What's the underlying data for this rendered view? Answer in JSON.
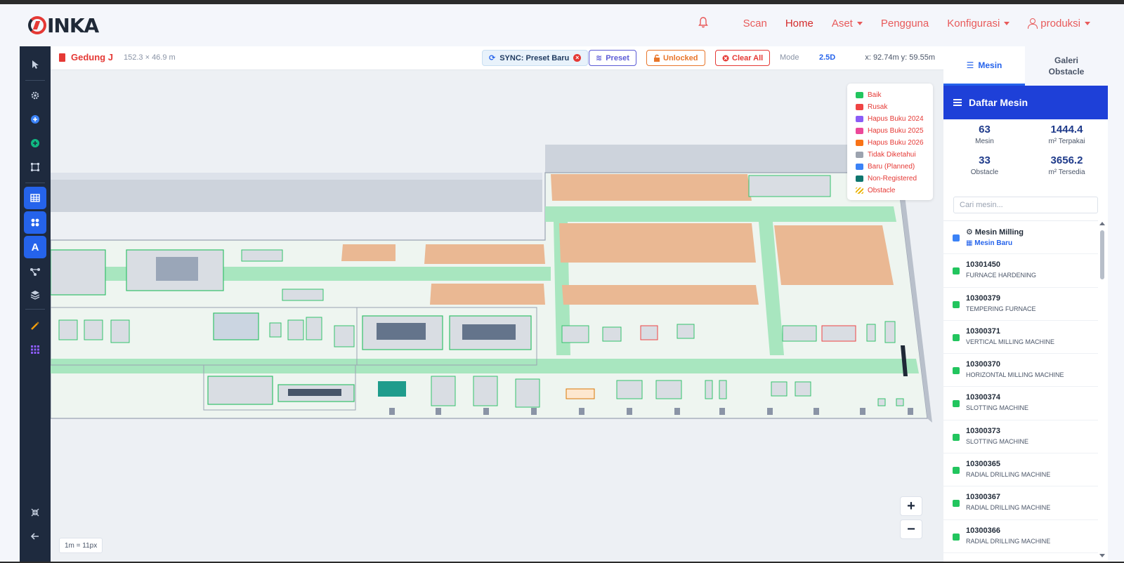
{
  "brand": {
    "logo_text": "INKA"
  },
  "nav": {
    "items": [
      {
        "label": "Scan"
      },
      {
        "label": "Home"
      },
      {
        "label": "Aset"
      },
      {
        "label": "Pengguna"
      },
      {
        "label": "Konfigurasi"
      },
      {
        "label": "produksi"
      }
    ]
  },
  "map": {
    "building": "Gedung J",
    "dimensions": "152.3 × 46.9 m",
    "sync_label": "SYNC: Preset Baru",
    "preset_label": "Preset",
    "unlocked_label": "Unlocked",
    "clear_label": "Clear All",
    "mode_label": "Mode",
    "mode_value": "2.5D",
    "coord": "x: 92.74m y: 59.55m",
    "scale": "1m = 11px",
    "zoom_in": "+",
    "zoom_out": "−",
    "legend": [
      {
        "label": "Baik",
        "color": "#22c55e"
      },
      {
        "label": "Rusak",
        "color": "#ef4444"
      },
      {
        "label": "Hapus Buku 2024",
        "color": "#8b5cf6"
      },
      {
        "label": "Hapus Buku 2025",
        "color": "#ec4899"
      },
      {
        "label": "Hapus Buku 2026",
        "color": "#f97316"
      },
      {
        "label": "Tidak Diketahui",
        "color": "#9ca3af"
      },
      {
        "label": "Baru (Planned)",
        "color": "#3b82f6"
      },
      {
        "label": "Non-Registered",
        "color": "#0f766e"
      },
      {
        "label": "Obstacle",
        "color": "#eab308"
      }
    ]
  },
  "panel": {
    "tab_mesin": "Mesin",
    "tab_galeri": "Galeri Obstacle",
    "header": "Daftar Mesin",
    "stats": [
      {
        "value": "63",
        "label": "Mesin"
      },
      {
        "value": "1444.4",
        "label": "m² Terpakai"
      },
      {
        "value": "33",
        "label": "Obstacle"
      },
      {
        "value": "3656.2",
        "label": "m² Tersedia"
      }
    ],
    "search_placeholder": "Cari mesin...",
    "machines": [
      {
        "id": "Mesin Milling",
        "name": "Mesin Baru"
      },
      {
        "id": "10301450",
        "name": "FURNACE HARDENING"
      },
      {
        "id": "10300379",
        "name": "TEMPERING FURNACE"
      },
      {
        "id": "10300371",
        "name": "VERTICAL MILLING MACHINE"
      },
      {
        "id": "10300370",
        "name": "HORIZONTAL MILLING MACHINE"
      },
      {
        "id": "10300374",
        "name": "SLOTTING MACHINE"
      },
      {
        "id": "10300373",
        "name": "SLOTTING MACHINE"
      },
      {
        "id": "10300365",
        "name": "RADIAL DRILLING MACHINE"
      },
      {
        "id": "10300367",
        "name": "RADIAL DRILLING MACHINE"
      },
      {
        "id": "10300366",
        "name": "RADIAL DRILLING MACHINE"
      }
    ]
  }
}
